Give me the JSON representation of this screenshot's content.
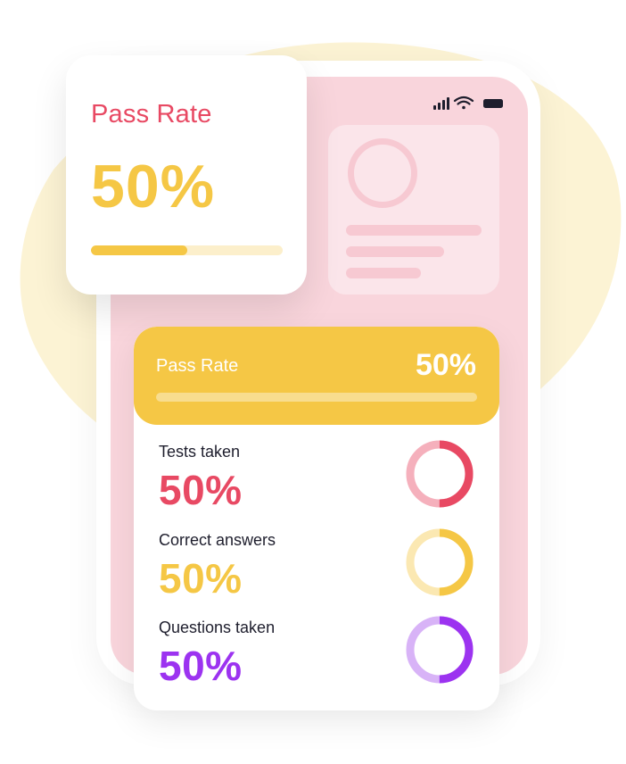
{
  "colors": {
    "pink": "#e84963",
    "pink_light": "#f5b0bc",
    "yellow": "#f5c745",
    "yellow_light": "#fbe8b2",
    "purple": "#9c33f0",
    "purple_light": "#d8b3f7",
    "phone_screen": "#f9d5dc",
    "backdrop_blob": "#fcf3d4"
  },
  "status_bar": {
    "icons": [
      "signal-icon",
      "wifi-icon",
      "battery-icon"
    ]
  },
  "pass_rate_card": {
    "title": "Pass Rate",
    "value": "50%",
    "progress": 0.5
  },
  "stats_card": {
    "header": {
      "label": "Pass Rate",
      "value": "50%"
    },
    "items": [
      {
        "label": "Tests taken",
        "value": "50%",
        "progress": 0.5,
        "color": "#e84963",
        "track_color": "#f5b0bc"
      },
      {
        "label": "Correct answers",
        "value": "50%",
        "progress": 0.5,
        "color": "#f5c745",
        "track_color": "#fbe8b2"
      },
      {
        "label": "Questions taken",
        "value": "50%",
        "progress": 0.5,
        "color": "#9c33f0",
        "track_color": "#d8b3f7"
      }
    ]
  }
}
